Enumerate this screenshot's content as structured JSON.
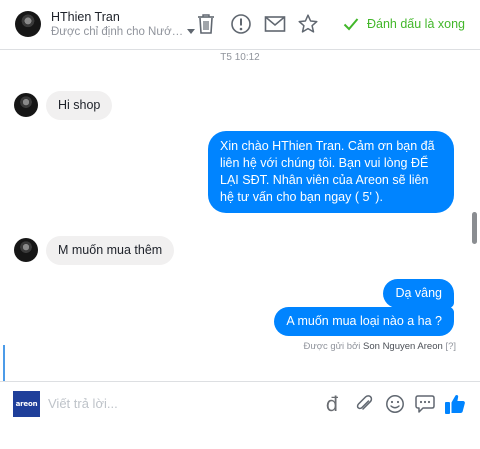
{
  "header": {
    "contact_name": "HThien Tran",
    "assigned_to": "Được chỉ định cho Nước ...",
    "mark_done_label": "Đánh dấu là xong",
    "accent_color": "#42b72a"
  },
  "conversation": {
    "timestamp": "T5 10:12",
    "messages": [
      {
        "direction": "incoming",
        "text": "Hi shop"
      },
      {
        "direction": "outgoing",
        "text": "Xin chào HThien Tran. Cảm ơn bạn đã liên hệ với chúng tôi. Bạn vui lòng ĐỂ LẠI SĐT. Nhân viên của Areon sẽ liên hệ tư vấn cho bạn ngay ( 5' )."
      },
      {
        "direction": "incoming",
        "text": "M muốn mua thêm"
      },
      {
        "direction": "outgoing",
        "text": "Dạ vâng"
      },
      {
        "direction": "outgoing",
        "text": "A muốn mua loại nào a ha ?"
      }
    ],
    "sent_by_prefix": "Được gửi bởi",
    "sent_by_name": "Son Nguyen Areon",
    "sent_by_help": "[?]",
    "outgoing_color": "#0084ff",
    "incoming_color": "#f1f0f0"
  },
  "composer": {
    "brand_text": "areon",
    "placeholder": "Viết trả lời...",
    "currency_symbol": "đ",
    "icons": [
      "payment-icon",
      "attachment-icon",
      "emoji-icon",
      "saved-replies-icon",
      "like-icon"
    ]
  }
}
